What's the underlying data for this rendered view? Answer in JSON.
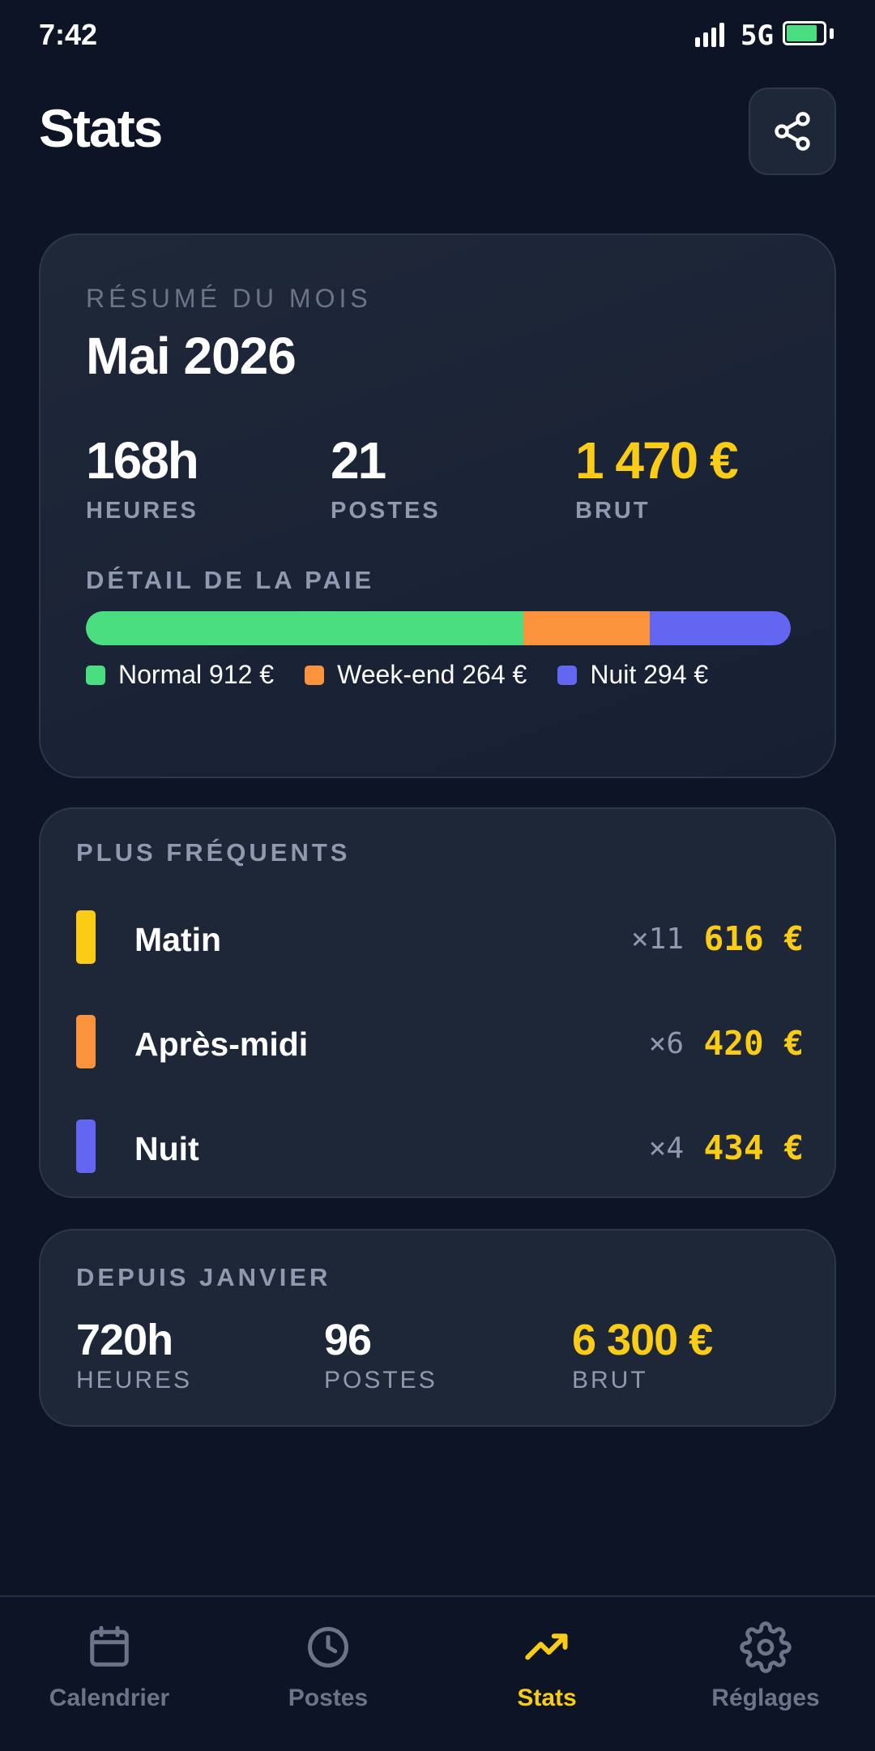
{
  "status_bar": {
    "time": "7:42",
    "network": "5G",
    "battery_level": 0.85,
    "icons": [
      "signal-icon",
      "battery-icon"
    ]
  },
  "header": {
    "title": "Stats",
    "share_icon": "share-icon"
  },
  "summary": {
    "eyebrow": "RÉSUMÉ DU MOIS",
    "month": "Mai 2026",
    "stats": [
      {
        "value": "168h",
        "label": "HEURES"
      },
      {
        "value": "21",
        "label": "POSTES"
      },
      {
        "value": "1 470 €",
        "label": "BRUT"
      }
    ],
    "pay_detail_label": "DÉTAIL DE LA PAIE",
    "pay_breakdown": [
      {
        "name": "Normal",
        "amount": 912,
        "text": "Normal 912 €",
        "color": "#4ade80"
      },
      {
        "name": "Week-end",
        "amount": 264,
        "text": "Week-end 264 €",
        "color": "#fb923c"
      },
      {
        "name": "Nuit",
        "amount": 294,
        "text": "Nuit 294 €",
        "color": "#6366f1"
      }
    ]
  },
  "frequent": {
    "label": "PLUS FRÉQUENTS",
    "items": [
      {
        "name": "Matin",
        "count": "×11",
        "amount": "616 €",
        "color": "#facc15"
      },
      {
        "name": "Après-midi",
        "count": "×6",
        "amount": "420 €",
        "color": "#fb923c"
      },
      {
        "name": "Nuit",
        "count": "×4",
        "amount": "434 €",
        "color": "#6366f1"
      }
    ]
  },
  "since_january": {
    "label": "DEPUIS JANVIER",
    "stats": [
      {
        "value": "720h",
        "label": "HEURES"
      },
      {
        "value": "96",
        "label": "POSTES"
      },
      {
        "value": "6 300 €",
        "label": "BRUT"
      }
    ]
  },
  "bottom_nav": {
    "items": [
      {
        "label": "Calendrier",
        "icon": "calendar-icon",
        "active": false
      },
      {
        "label": "Postes",
        "icon": "clock-icon",
        "active": false
      },
      {
        "label": "Stats",
        "icon": "trending-up-icon",
        "active": true
      },
      {
        "label": "Réglages",
        "icon": "gear-icon",
        "active": false
      }
    ]
  },
  "colors": {
    "background": "#0d1426",
    "card": "#1e2738",
    "accent": "#facc15",
    "muted": "#8f9ab0"
  }
}
